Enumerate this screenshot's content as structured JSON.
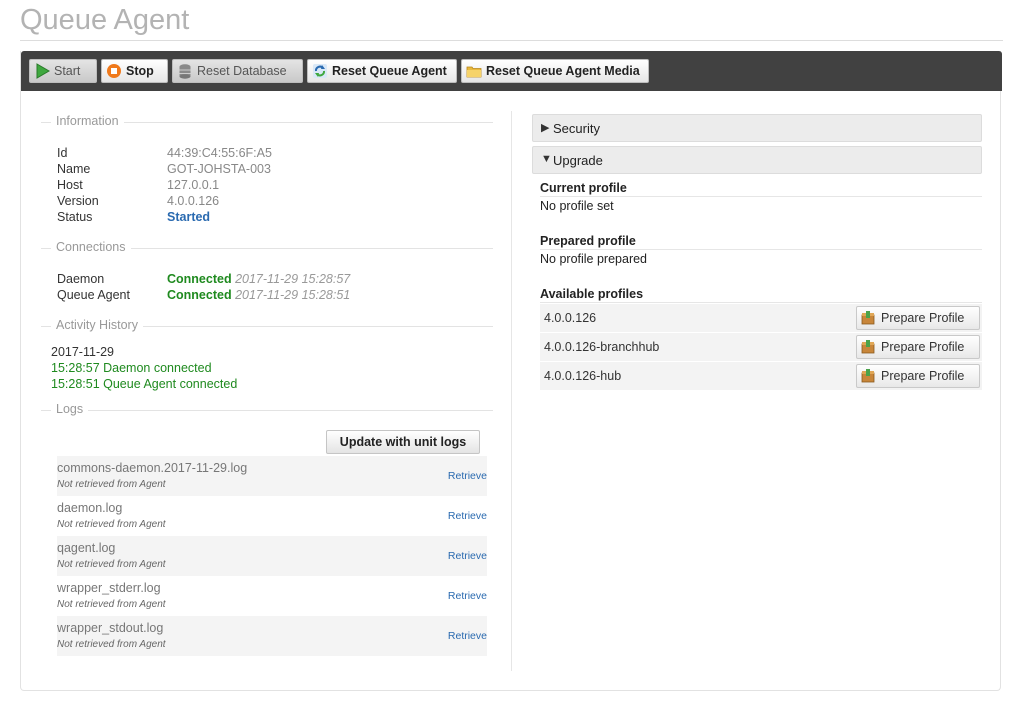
{
  "page": {
    "title": "Queue Agent"
  },
  "toolbar": {
    "start": "Start",
    "stop": "Stop",
    "reset_database": "Reset Database",
    "reset_queue_agent": "Reset Queue Agent",
    "reset_queue_agent_media": "Reset Queue Agent Media"
  },
  "information": {
    "legend": "Information",
    "rows": [
      {
        "label": "Id",
        "value": "44:39:C4:55:6F:A5"
      },
      {
        "label": "Name",
        "value": "GOT-JOHSTA-003"
      },
      {
        "label": "Host",
        "value": "127.0.0.1"
      },
      {
        "label": "Version",
        "value": "4.0.0.126"
      },
      {
        "label": "Status",
        "value": "Started"
      }
    ]
  },
  "connections": {
    "legend": "Connections",
    "rows": [
      {
        "label": "Daemon",
        "status": "Connected",
        "time": "2017-11-29 15:28:57"
      },
      {
        "label": "Queue Agent",
        "status": "Connected",
        "time": "2017-11-29 15:28:51"
      }
    ]
  },
  "activity": {
    "legend": "Activity History",
    "date": "2017-11-29",
    "entries": [
      "15:28:57 Daemon connected",
      "15:28:51 Queue Agent connected"
    ]
  },
  "logs": {
    "legend": "Logs",
    "update_button": "Update with unit logs",
    "items": [
      {
        "name": "commons-daemon.2017-11-29.log",
        "status": "Not retrieved from Agent",
        "action": "Retrieve"
      },
      {
        "name": "daemon.log",
        "status": "Not retrieved from Agent",
        "action": "Retrieve"
      },
      {
        "name": "qagent.log",
        "status": "Not retrieved from Agent",
        "action": "Retrieve"
      },
      {
        "name": "wrapper_stderr.log",
        "status": "Not retrieved from Agent",
        "action": "Retrieve"
      },
      {
        "name": "wrapper_stdout.log",
        "status": "Not retrieved from Agent",
        "action": "Retrieve"
      }
    ]
  },
  "security": {
    "label": "Security",
    "arrow": "▶"
  },
  "upgrade": {
    "label": "Upgrade",
    "arrow": "▼",
    "current_heading": "Current profile",
    "current_value": "No profile set",
    "prepared_heading": "Prepared profile",
    "prepared_value": "No profile prepared",
    "available_heading": "Available profiles",
    "profiles": [
      {
        "name": "4.0.0.126",
        "button": "Prepare Profile"
      },
      {
        "name": "4.0.0.126-branchhub",
        "button": "Prepare Profile"
      },
      {
        "name": "4.0.0.126-hub",
        "button": "Prepare Profile"
      }
    ]
  },
  "colors": {
    "toolbar_bg": "#414141",
    "link": "#2a6ab0",
    "connected": "#1f8a1f",
    "title": "#b3b3b3"
  },
  "icons": [
    "play-icon",
    "stop-icon",
    "database-icon",
    "refresh-icon",
    "folder-icon",
    "package-icon"
  ]
}
